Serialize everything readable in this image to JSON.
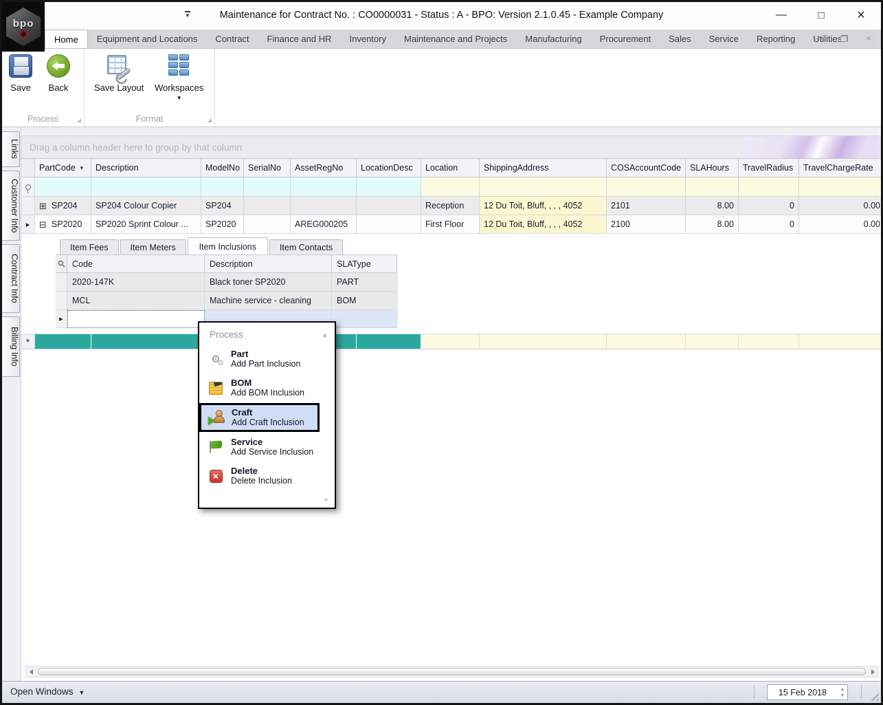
{
  "window": {
    "title": "Maintenance for Contract No. : CO0000031 - Status : A - BPO: Version 2.1.0.45 - Example Company",
    "logo_text": "bpo"
  },
  "icons": {
    "minimize": "—",
    "maximize": "□",
    "close": "×",
    "ribbon_minimize": "—",
    "ribbon_close": "×",
    "dropdown_arrow": "▼",
    "sort_filter_arrow": "▼",
    "expand_collapsed": "⊞",
    "expand_expanded": "⊟",
    "row_pointer": "▸",
    "new_row_marker": "*",
    "scroll_up": "▲",
    "scroll_down": "▼",
    "spin_up": "▲",
    "spin_down": "▼",
    "delete_x": "×"
  },
  "ribbon": {
    "tabs": [
      "Home",
      "Equipment and Locations",
      "Contract",
      "Finance and HR",
      "Inventory",
      "Maintenance and Projects",
      "Manufacturing",
      "Procurement",
      "Sales",
      "Service",
      "Reporting",
      "Utilities"
    ],
    "active_tab": "Home",
    "groups": {
      "process": {
        "label": "Process",
        "save_label": "Save",
        "back_label": "Back"
      },
      "format": {
        "label": "Format",
        "save_layout_label": "Save Layout",
        "workspaces_label": "Workspaces"
      }
    }
  },
  "sidebar": {
    "tabs": [
      "Links",
      "Customer Info",
      "Contract Info",
      "Billing Info"
    ]
  },
  "grid": {
    "group_by_hint": "Drag a column header here to group by that column",
    "columns": [
      "PartCode",
      "Description",
      "ModelNo",
      "SerialNo",
      "AssetRegNo",
      "LocationDesc",
      "Location",
      "ShippingAddress",
      "COSAccountCode",
      "SLAHours",
      "TravelRadius",
      "TravelChargeRate"
    ],
    "rows": [
      {
        "expand_state": "collapsed",
        "cells": [
          "SP204",
          "SP204 Colour Copier",
          "SP204",
          "",
          "",
          "",
          "Reception",
          "12 Du Toit, Bluff, , , , 4052",
          "2101",
          "8.00",
          "0",
          "0.00"
        ]
      },
      {
        "expand_state": "expanded",
        "cells": [
          "SP2020",
          "SP2020 Sprint Colour ...",
          "SP2020",
          "",
          "AREG000205",
          "",
          "First Floor",
          "12 Du Toit, Bluff, , , , 4052",
          "2100",
          "8.00",
          "0",
          "0.00"
        ]
      }
    ]
  },
  "detail": {
    "tabs": [
      "Item Fees",
      "Item Meters",
      "Item Inclusions",
      "Item Contacts"
    ],
    "active_tab": "Item Inclusions",
    "columns": [
      "Code",
      "Description",
      "SLAType"
    ],
    "rows": [
      [
        "2020-147K",
        "Black toner SP2020",
        "PART"
      ],
      [
        "MCL",
        "Machine service - cleaning",
        "BOM"
      ]
    ]
  },
  "context_menu": {
    "header": "Process",
    "items": [
      {
        "title": "Part",
        "subtitle": "Add Part Inclusion",
        "icon": "gears-icon"
      },
      {
        "title": "BOM",
        "subtitle": "Add BOM Inclusion",
        "icon": "bom-document-icon"
      },
      {
        "title": "Craft",
        "subtitle": "Add Craft Inclusion",
        "icon": "craft-person-icon",
        "highlighted": true
      },
      {
        "title": "Service",
        "subtitle": "Add Service Inclusion",
        "icon": "service-flag-icon"
      },
      {
        "title": "Delete",
        "subtitle": "Delete Inclusion",
        "icon": "delete-icon"
      }
    ]
  },
  "statusbar": {
    "open_windows_label": "Open Windows",
    "date_value": "15 Feb 2018"
  },
  "colors": {
    "teal_new_row": "#2BA99F",
    "filter_cyan": "#E2FBFB",
    "cell_yellow": "#FBF7D0",
    "highlight_blue": "#CFDEF6"
  }
}
